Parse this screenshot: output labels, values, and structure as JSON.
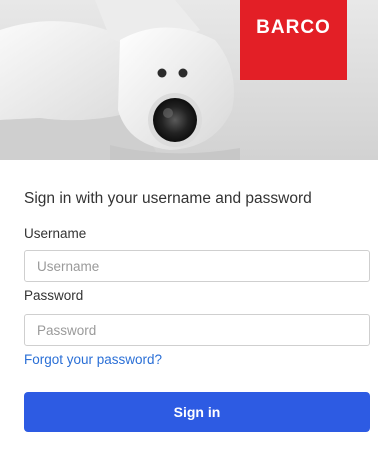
{
  "brand": {
    "logo_text": "BARCO",
    "logo_color": "#e31f26"
  },
  "hero": {
    "image": "camera-device-image"
  },
  "form": {
    "heading": "Sign in with your username and password",
    "username_label": "Username",
    "username_placeholder": "Username",
    "username_value": "",
    "password_label": "Password",
    "password_placeholder": "Password",
    "password_value": "",
    "forgot_link": "Forgot your password?",
    "submit_label": "Sign in"
  },
  "colors": {
    "primary_button": "#2d5be3",
    "link": "#2a6fd6"
  }
}
